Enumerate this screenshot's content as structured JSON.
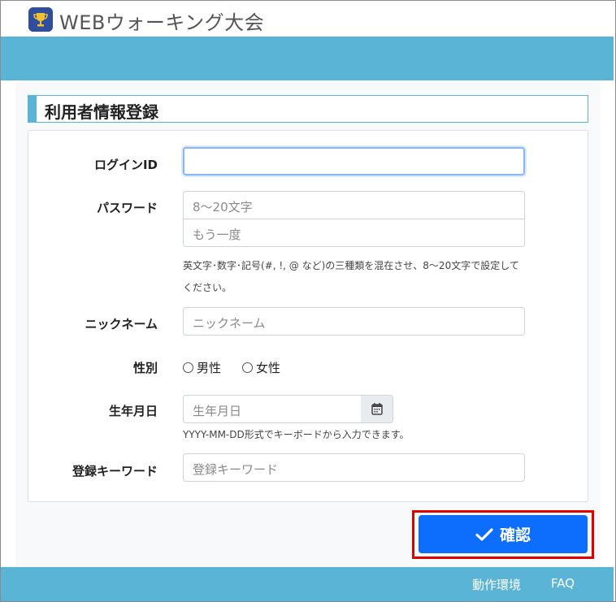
{
  "app": {
    "title": "WEBウォーキング大会",
    "logo_icon": "trophy-icon"
  },
  "section": {
    "title": "利用者情報登録"
  },
  "form": {
    "login_id": {
      "label": "ログインID",
      "value": "",
      "placeholder": ""
    },
    "password": {
      "label": "パスワード",
      "placeholder": "8～20文字",
      "confirm_placeholder": "もう一度"
    },
    "password_help": "英文字･数字･記号(#, !, @ など)の三種類を混在させ、8～20文字で設定してください。",
    "nickname": {
      "label": "ニックネーム",
      "placeholder": "ニックネーム"
    },
    "gender": {
      "label": "性別",
      "options": [
        "男性",
        "女性"
      ]
    },
    "birthdate": {
      "label": "生年月日",
      "placeholder": "生年月日",
      "help": "YYYY-MM-DD形式でキーボードから入力できます。",
      "calendar_icon": "calendar-icon"
    },
    "keyword": {
      "label": "登録キーワード",
      "placeholder": "登録キーワード"
    }
  },
  "actions": {
    "confirm_label": "確認",
    "confirm_icon": "checkmark-icon"
  },
  "footer": {
    "links": [
      "動作環境",
      "FAQ"
    ]
  },
  "colors": {
    "accent": "#5ab4d6",
    "primary": "#0d6efd",
    "highlight": "#e00000"
  }
}
